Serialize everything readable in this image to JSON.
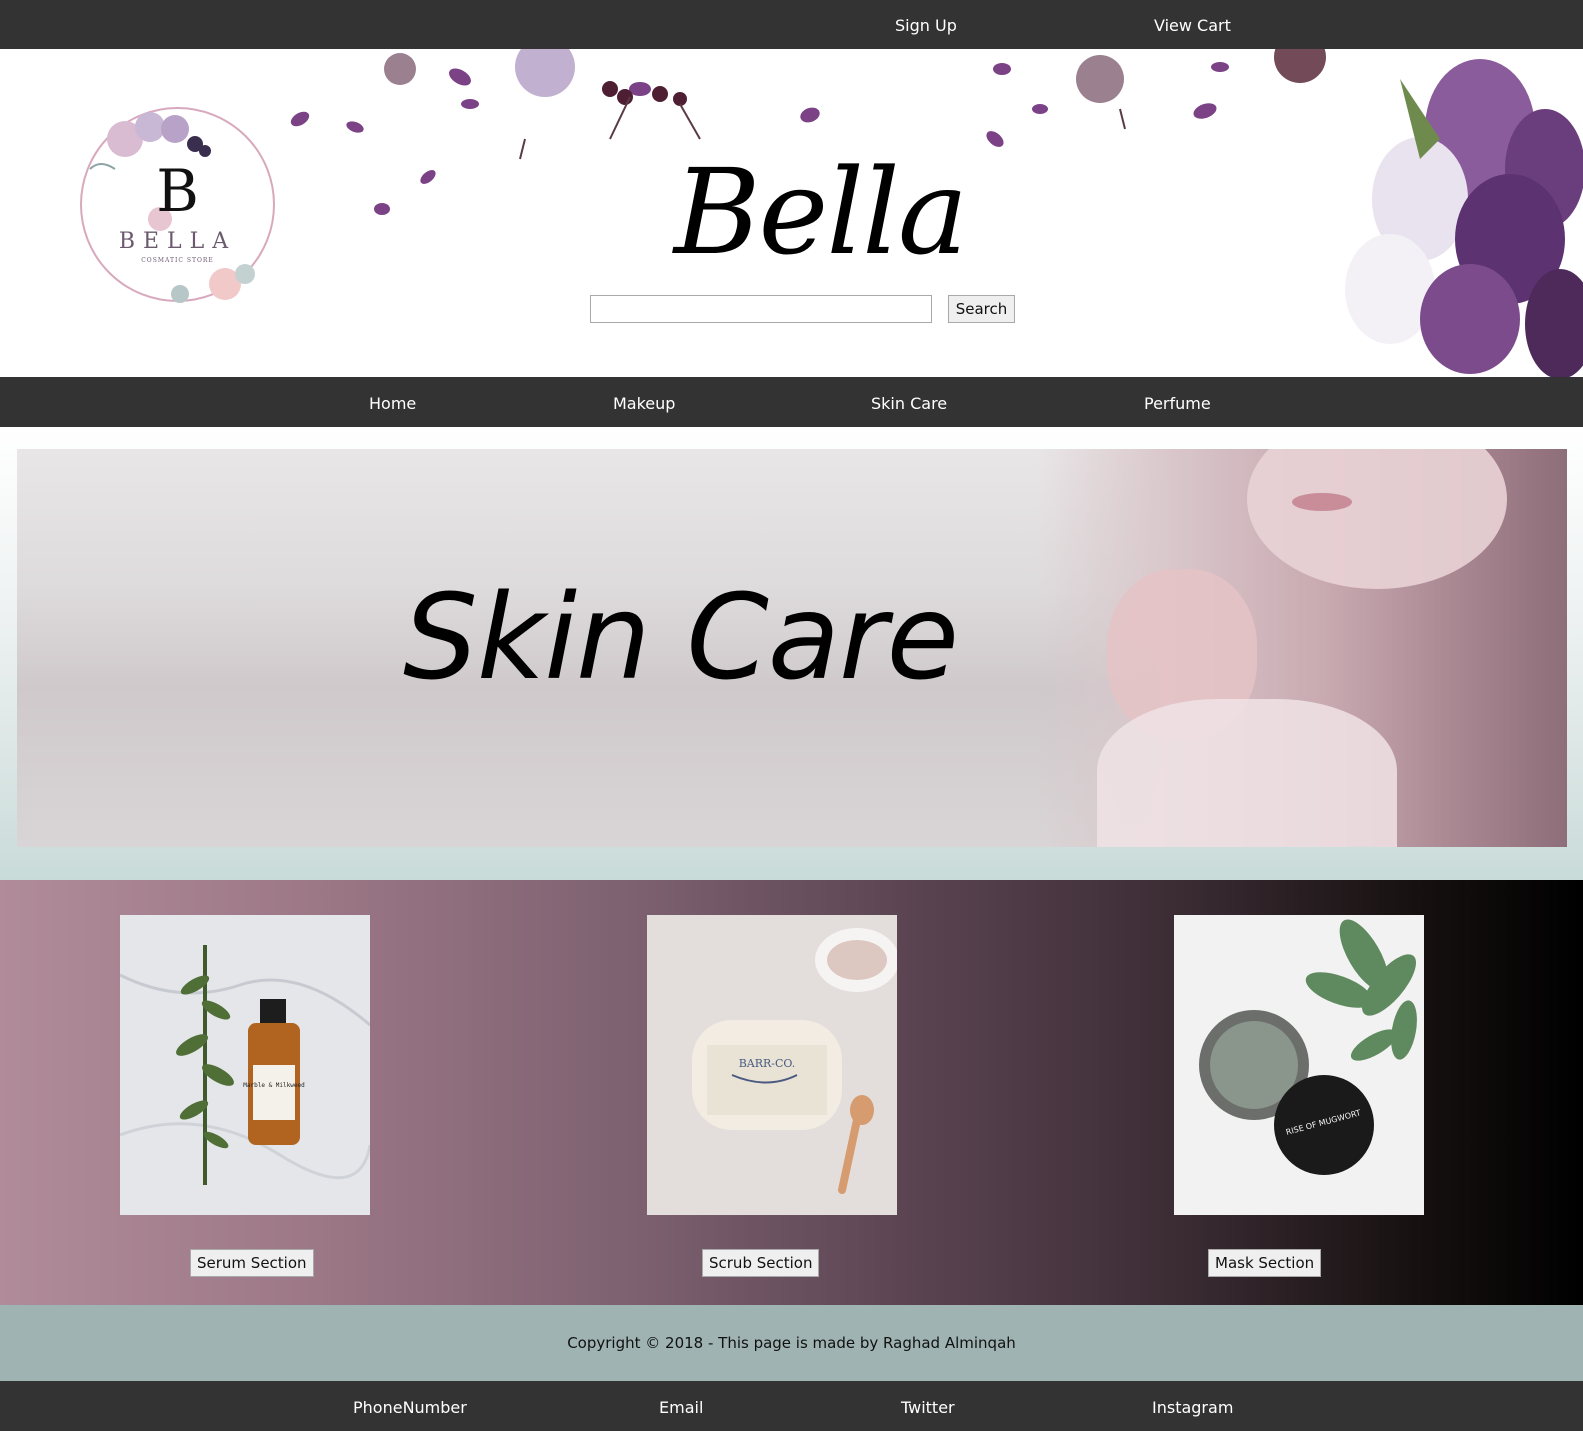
{
  "topbar": {
    "signup": "Sign Up",
    "cart": "View Cart"
  },
  "logo": {
    "letter": "B",
    "name": "BELLA",
    "subtitle": "COSMATIC STORE"
  },
  "header": {
    "brand": "Bella",
    "search_button": "Search",
    "search_value": ""
  },
  "nav": {
    "items": [
      "Home",
      "Makeup",
      "Skin Care",
      "Perfume"
    ]
  },
  "hero": {
    "title": "Skin Care"
  },
  "products": [
    {
      "button": "Serum Section",
      "image": "serum-bottle-image",
      "product_label": "Marble & Milkweed"
    },
    {
      "button": "Scrub Section",
      "image": "scrub-jar-image",
      "product_label": "BARR-CO."
    },
    {
      "button": "Mask Section",
      "image": "mask-jar-image",
      "product_label": "RISE OF MUGWORT"
    }
  ],
  "footer": {
    "copyright": "Copyright © 2018 - This page is made by Raghad Alminqah",
    "links": [
      "PhoneNumber",
      "Email",
      "Twitter",
      "Instagram"
    ]
  },
  "colors": {
    "bar": "#333333",
    "footer_band": "#9fb4b2",
    "accent_mauve": "#b08b9a"
  }
}
